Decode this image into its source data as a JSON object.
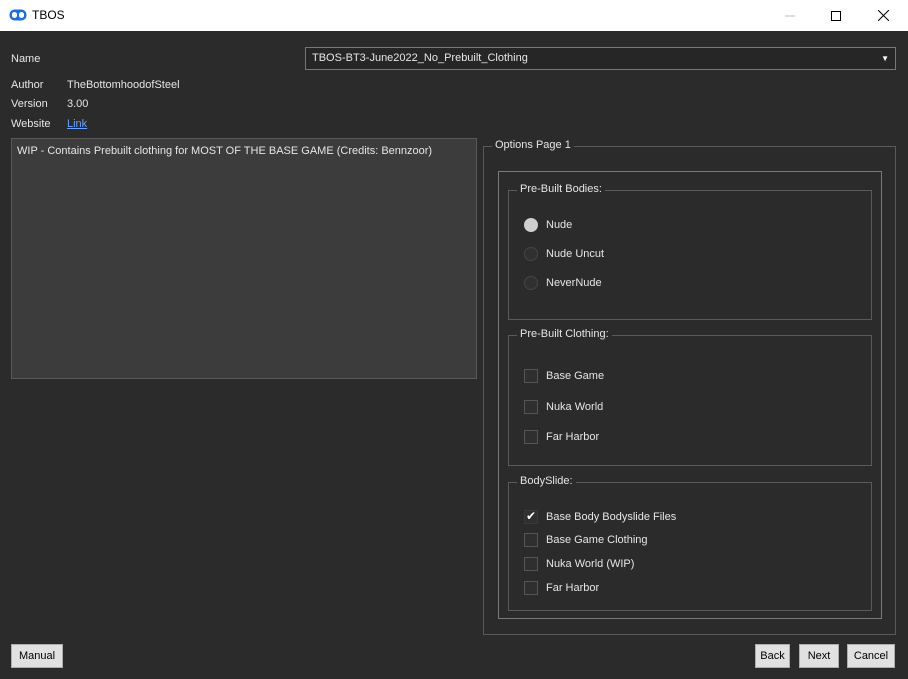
{
  "window": {
    "title": "TBOS"
  },
  "labels": {
    "name": "Name",
    "author": "Author",
    "version": "Version",
    "website": "Website"
  },
  "mod": {
    "name_value": "TBOS-BT3-June2022_No_Prebuilt_Clothing",
    "author": "TheBottomhoodofSteel",
    "version": "3.00",
    "website_link": "Link",
    "description": "WIP - Contains Prebuilt clothing for MOST OF THE BASE GAME (Credits: Bennzoor)"
  },
  "options_page": {
    "title": "Options Page 1",
    "groups": [
      {
        "title": "Pre-Built Bodies:",
        "type": "radio",
        "options": [
          {
            "label": "Nude",
            "checked": true
          },
          {
            "label": "Nude Uncut",
            "checked": false
          },
          {
            "label": "NeverNude",
            "checked": false
          }
        ]
      },
      {
        "title": "Pre-Built Clothing:",
        "type": "checkbox",
        "options": [
          {
            "label": "Base Game",
            "checked": false
          },
          {
            "label": "Nuka World",
            "checked": false
          },
          {
            "label": "Far Harbor",
            "checked": false
          }
        ]
      },
      {
        "title": "BodySlide:",
        "type": "checkbox",
        "options": [
          {
            "label": "Base Body Bodyslide Files",
            "checked": true
          },
          {
            "label": "Base Game Clothing",
            "checked": false
          },
          {
            "label": "Nuka World (WIP)",
            "checked": false
          },
          {
            "label": "Far Harbor",
            "checked": false
          }
        ]
      }
    ]
  },
  "buttons": {
    "manual": "Manual",
    "back": "Back",
    "next": "Next",
    "cancel": "Cancel"
  },
  "icons": {
    "app": "tbos-logo-icon",
    "minimize": "minimize-icon",
    "maximize": "maximize-icon",
    "close": "close-icon",
    "dropdown": "chevron-down-icon",
    "check": "checkmark-icon"
  }
}
